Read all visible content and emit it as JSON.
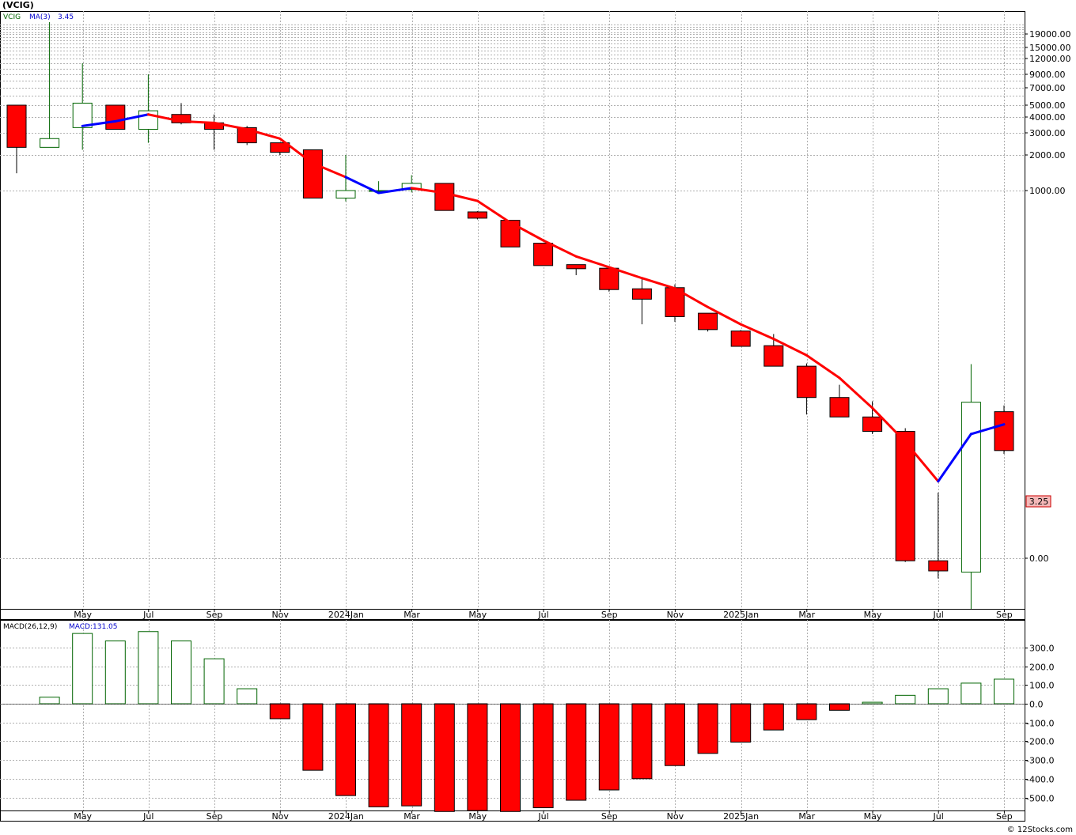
{
  "title": "(VCIG)",
  "credit": "© 12Stocks.com",
  "price_panel": {
    "legend_symbol": "VCIG",
    "legend_ma_label": "MA(3)",
    "legend_ma_value": "3.45",
    "last_price_label": "3.25",
    "y_tick_labels": [
      "19000.00",
      "15000.00",
      "12000.00",
      "9000.00",
      "7000.00",
      "5000.00",
      "4000.00",
      "3000.00",
      "2000.00",
      "1000.00",
      "0.00"
    ]
  },
  "macd_panel": {
    "legend_label": "MACD(26,12,9)",
    "legend_value": "MACD:131.05",
    "y_tick_labels": [
      "300.0",
      "200.0",
      "100.0",
      "0.0",
      "-100.0",
      "-200.0",
      "-300.0",
      "-400.0",
      "-500.0"
    ]
  },
  "x_tick_labels": [
    "May",
    "Jul",
    "Sep",
    "Nov",
    "2024Jan",
    "Mar",
    "May",
    "Jul",
    "Sep",
    "Nov",
    "2025Jan",
    "Mar",
    "May",
    "Jul",
    "Sep"
  ],
  "colors": {
    "up": "#ffffff",
    "up_border": "#006400",
    "down": "#ff0000",
    "down_border": "#000000",
    "ma_up": "#0000ff",
    "ma_down": "#ff0000",
    "grid": "#b0b0b0"
  },
  "chart_data": [
    {
      "type": "candlestick",
      "title": "(VCIG)",
      "scale": "log-like",
      "period": "monthly",
      "series_ma": "MA(3)",
      "candles": [
        {
          "o": 5000,
          "h": 5000,
          "l": 1400,
          "c": 2300
        },
        {
          "o": 2300,
          "h": 28000,
          "l": 2300,
          "c": 2700
        },
        {
          "o": 3300,
          "h": 11000,
          "l": 2200,
          "c": 5200
        },
        {
          "o": 5000,
          "h": 5000,
          "l": 3200,
          "c": 3200
        },
        {
          "o": 3200,
          "h": 9000,
          "l": 2500,
          "c": 4500
        },
        {
          "o": 4200,
          "h": 5200,
          "l": 3500,
          "c": 3600
        },
        {
          "o": 3600,
          "h": 4200,
          "l": 2200,
          "c": 3200
        },
        {
          "o": 3300,
          "h": 3400,
          "l": 2400,
          "c": 2500
        },
        {
          "o": 2500,
          "h": 2500,
          "l": 2000,
          "c": 2100
        },
        {
          "o": 2200,
          "h": 2200,
          "l": 850,
          "c": 850
        },
        {
          "o": 850,
          "h": 2000,
          "l": 790,
          "c": 1000
        },
        {
          "o": 1000,
          "h": 1200,
          "l": 940,
          "c": 1000
        },
        {
          "o": 1020,
          "h": 1350,
          "l": 960,
          "c": 1150
        },
        {
          "o": 1150,
          "h": 1150,
          "l": 650,
          "c": 650
        },
        {
          "o": 630,
          "h": 640,
          "l": 535,
          "c": 550
        },
        {
          "o": 525,
          "h": 525,
          "l": 295,
          "c": 295
        },
        {
          "o": 320,
          "h": 320,
          "l": 197,
          "c": 197
        },
        {
          "o": 201,
          "h": 201,
          "l": 160,
          "c": 184
        },
        {
          "o": 186,
          "h": 191,
          "l": 112,
          "c": 117
        },
        {
          "o": 119,
          "h": 153,
          "l": 55,
          "c": 95
        },
        {
          "o": 122,
          "h": 131,
          "l": 58,
          "c": 65
        },
        {
          "o": 70,
          "h": 70,
          "l": 47,
          "c": 49
        },
        {
          "o": 47.5,
          "h": 48.5,
          "l": 34,
          "c": 34
        },
        {
          "o": 34.5,
          "h": 44.5,
          "l": 22,
          "c": 22
        },
        {
          "o": 22,
          "h": 23.4,
          "l": 7.5,
          "c": 11
        },
        {
          "o": 11,
          "h": 14.6,
          "l": 7.1,
          "c": 7.1
        },
        {
          "o": 7.1,
          "h": 10.1,
          "l": 4.8,
          "c": 5.1
        },
        {
          "o": 5.1,
          "h": 5.5,
          "l": -0.3,
          "c": -0.2
        },
        {
          "o": -0.2,
          "h": 1.1,
          "l": -1.6,
          "c": -1.0
        },
        {
          "o": -1.1,
          "h": 23,
          "l": -4.1,
          "c": 9.9
        },
        {
          "o": 8.0,
          "h": 9.2,
          "l": 3.0,
          "c": 3.25
        }
      ],
      "ma": [
        null,
        null,
        3400,
        3700,
        4200,
        3700,
        3600,
        3200,
        2700,
        1700,
        1300,
        950,
        1050,
        950,
        800,
        500,
        340,
        240,
        190,
        150,
        120,
        80,
        55,
        40,
        28,
        17,
        8.7,
        4.0,
        1.5,
        4.8,
        6.0
      ],
      "ma_rising": [
        null,
        null,
        true,
        true,
        true,
        false,
        false,
        false,
        false,
        false,
        false,
        true,
        true,
        false,
        false,
        false,
        false,
        false,
        false,
        false,
        false,
        false,
        false,
        false,
        false,
        false,
        false,
        false,
        false,
        true,
        true
      ]
    },
    {
      "type": "bar",
      "title": "MACD(26,12,9)",
      "values": [
        null,
        35,
        375,
        335,
        385,
        335,
        240,
        80,
        -80,
        -355,
        -490,
        -550,
        -545,
        -575,
        -570,
        -575,
        -555,
        -515,
        -460,
        -400,
        -330,
        -265,
        -205,
        -140,
        -85,
        -35,
        8,
        45,
        80,
        110,
        131.05
      ],
      "ylim": [
        -575,
        425
      ]
    }
  ]
}
